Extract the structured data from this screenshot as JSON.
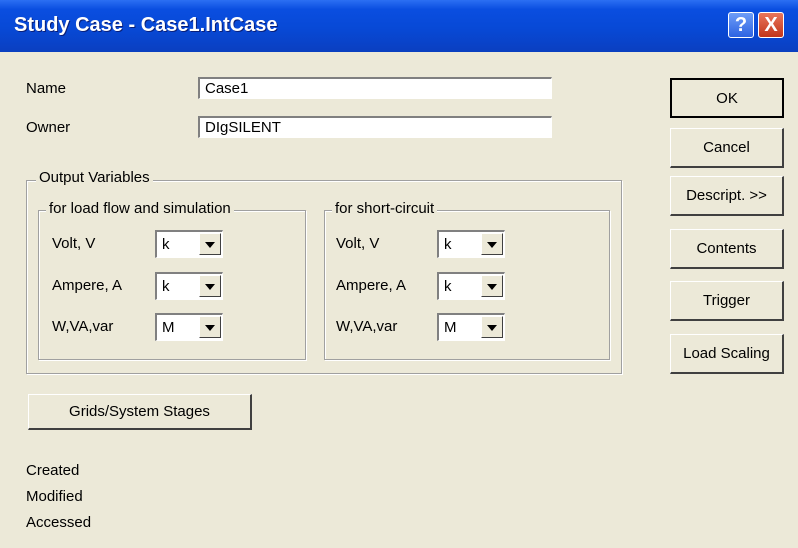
{
  "window": {
    "title": "Study Case - Case1.IntCase"
  },
  "titlebar_buttons": {
    "help": "?",
    "close": "X"
  },
  "fields": {
    "name_label": "Name",
    "name_value": "Case1",
    "owner_label": "Owner",
    "owner_value": "DIgSILENT"
  },
  "output_variables": {
    "title": "Output Variables",
    "load_flow": {
      "title": "for load flow and simulation",
      "rows": [
        {
          "label": "Volt, V",
          "value": "k"
        },
        {
          "label": "Ampere, A",
          "value": "k"
        },
        {
          "label": "W,VA,var",
          "value": "M"
        }
      ]
    },
    "short_circuit": {
      "title": "for short-circuit",
      "rows": [
        {
          "label": "Volt, V",
          "value": "k"
        },
        {
          "label": "Ampere, A",
          "value": "k"
        },
        {
          "label": "W,VA,var",
          "value": "M"
        }
      ]
    }
  },
  "grids_button": "Grids/System Stages",
  "info": {
    "created": "Created",
    "modified": "Modified",
    "accessed": "Accessed"
  },
  "buttons": {
    "ok": "OK",
    "cancel": "Cancel",
    "descript": "Descript. >>",
    "contents": "Contents",
    "trigger": "Trigger",
    "load_scaling": "Load Scaling"
  }
}
